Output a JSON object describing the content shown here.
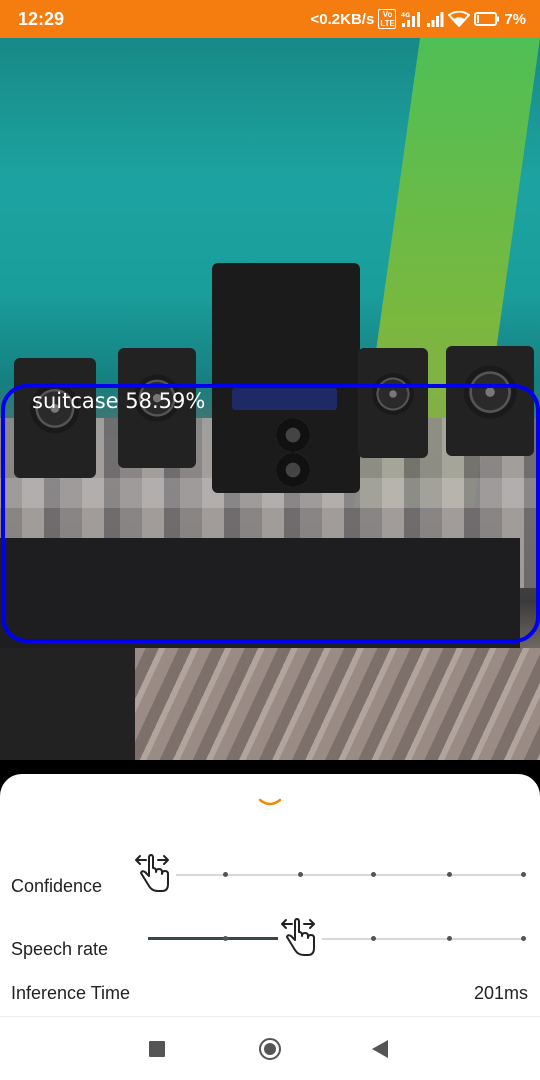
{
  "status_bar": {
    "time": "12:29",
    "network_speed": "<0.2KB/s",
    "volte_badge": "Vo LTE",
    "network_type": "4G",
    "battery": "7%",
    "color": "#f57c0f"
  },
  "camera": {
    "detection": {
      "label": "suitcase 58.59%",
      "box_color": "#0000ee"
    }
  },
  "sheet": {
    "confidence": {
      "label": "Confidence",
      "ticks": 6,
      "selected_index": 0
    },
    "speech_rate": {
      "label": "Speech rate",
      "ticks": 6,
      "selected_index": 2
    },
    "inference": {
      "label": "Inference Time",
      "value": "201ms"
    },
    "accent": "#f08a00"
  },
  "navbar": {
    "recents": "recents-icon",
    "home": "home-icon",
    "back": "back-icon"
  }
}
